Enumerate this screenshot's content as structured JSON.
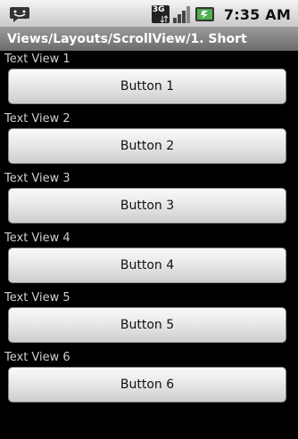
{
  "status_bar": {
    "network_label": "3G",
    "time": "7:35",
    "ampm": "AM",
    "icons": [
      "chat-notification-icon",
      "3g-data-icon",
      "signal-strength-icon",
      "battery-icon"
    ]
  },
  "title_bar": {
    "title": "Views/Layouts/ScrollView/1. Short"
  },
  "rows": [
    {
      "text_view": "Text View 1",
      "button": "Button 1"
    },
    {
      "text_view": "Text View 2",
      "button": "Button 2"
    },
    {
      "text_view": "Text View 3",
      "button": "Button 3"
    },
    {
      "text_view": "Text View 4",
      "button": "Button 4"
    },
    {
      "text_view": "Text View 5",
      "button": "Button 5"
    },
    {
      "text_view": "Text View 6",
      "button": "Button 6"
    }
  ],
  "colors": {
    "background": "#000000",
    "title_bar": "#7f7f7f",
    "battery_charge": "#4caf50"
  }
}
